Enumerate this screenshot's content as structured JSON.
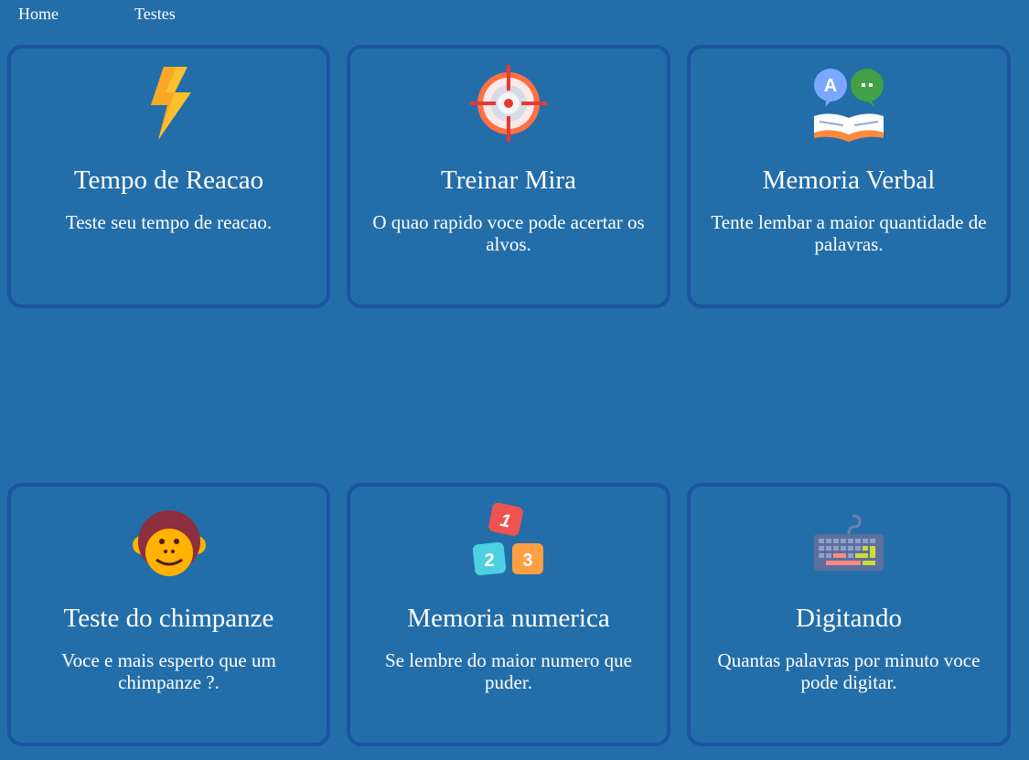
{
  "nav": {
    "home_label": "Home",
    "tests_label": "Testes"
  },
  "cards": [
    {
      "title": "Tempo de Reacao",
      "description": "Teste seu tempo de reacao.",
      "icon": "lightning-bolt-icon"
    },
    {
      "title": "Treinar Mira",
      "description": "O quao rapido voce pode acertar os alvos.",
      "icon": "crosshair-target-icon"
    },
    {
      "title": "Memoria Verbal",
      "description": "Tente lembar a maior quantidade de palavras.",
      "icon": "open-book-speech-bubbles-icon"
    },
    {
      "title": "Teste do chimpanze",
      "description": "Voce e mais esperto que um chimpanze ?.",
      "icon": "monkey-face-icon"
    },
    {
      "title": "Memoria numerica",
      "description": "Se lembre do maior numero que puder.",
      "icon": "number-blocks-icon"
    },
    {
      "title": "Digitando",
      "description": "Quantas palavras por minuto voce pode digitar.",
      "icon": "keyboard-icon"
    }
  ],
  "colors": {
    "background": "#236ea9",
    "card_border": "#1b55a0",
    "text": "#ffffff"
  }
}
